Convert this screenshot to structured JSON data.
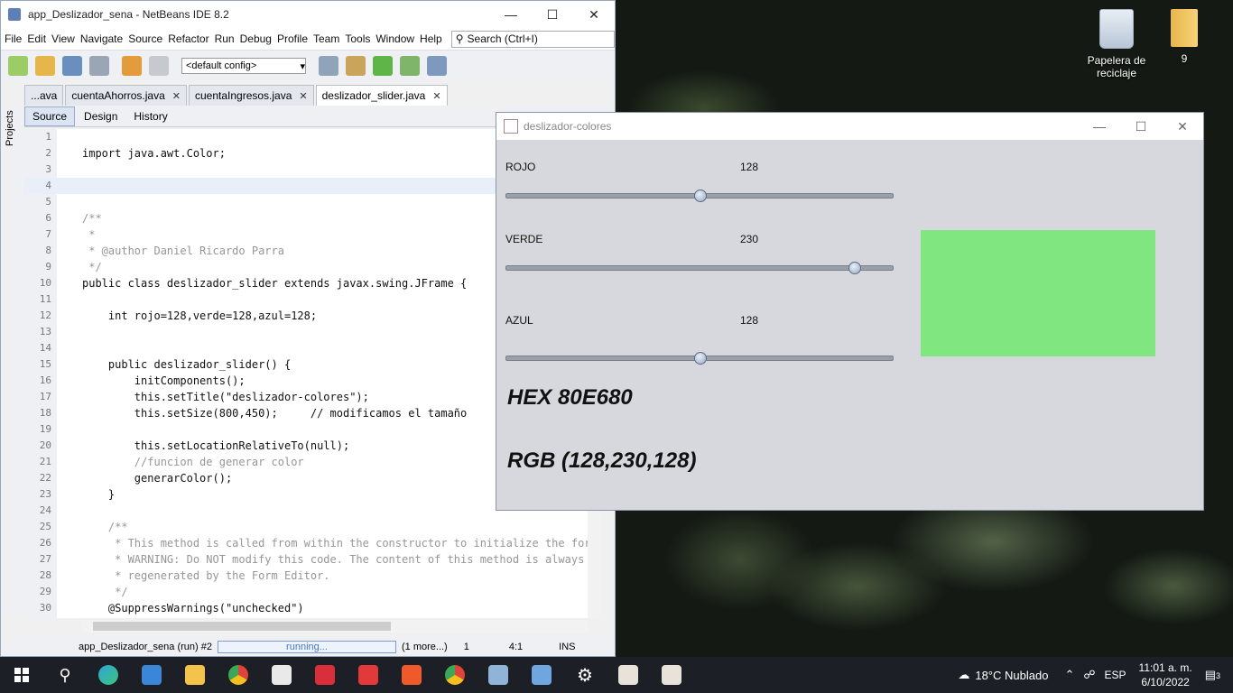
{
  "desktop": {
    "icons": [
      {
        "label": "Papelera de reciclaje"
      },
      {
        "label": "9"
      }
    ]
  },
  "netbeans": {
    "title": "app_Deslizador_sena - NetBeans IDE 8.2",
    "menu": [
      "File",
      "Edit",
      "View",
      "Navigate",
      "Source",
      "Refactor",
      "Run",
      "Debug",
      "Profile",
      "Team",
      "Tools",
      "Window",
      "Help"
    ],
    "search_placeholder": "Search (Ctrl+I)",
    "config": "<default config>",
    "side_panel": "Projects",
    "tabs": [
      "...ava",
      "cuentaAhorros.java",
      "cuentaIngresos.java",
      "deslizador_slider.java"
    ],
    "editor_tabs": [
      "Source",
      "Design",
      "History"
    ],
    "code_lines": [
      {
        "n": "1",
        "t": ""
      },
      {
        "n": "2",
        "t": "import java.awt.Color;"
      },
      {
        "n": "3",
        "t": ""
      },
      {
        "n": "4",
        "t": ""
      },
      {
        "n": "5",
        "t": ""
      },
      {
        "n": "6",
        "t": "/**"
      },
      {
        "n": "7",
        "t": " *"
      },
      {
        "n": "8",
        "t": " * @author Daniel Ricardo Parra"
      },
      {
        "n": "9",
        "t": " */"
      },
      {
        "n": "10",
        "t": "public class deslizador_slider extends javax.swing.JFrame {"
      },
      {
        "n": "11",
        "t": ""
      },
      {
        "n": "12",
        "t": "    int rojo=128,verde=128,azul=128;"
      },
      {
        "n": "13",
        "t": ""
      },
      {
        "n": "14",
        "t": ""
      },
      {
        "n": "15",
        "t": "    public deslizador_slider() {"
      },
      {
        "n": "16",
        "t": "        initComponents();"
      },
      {
        "n": "17",
        "t": "        this.setTitle(\"deslizador-colores\");"
      },
      {
        "n": "18",
        "t": "        this.setSize(800,450);     // modificamos el tamaño"
      },
      {
        "n": "19",
        "t": ""
      },
      {
        "n": "20",
        "t": "        this.setLocationRelativeTo(null);"
      },
      {
        "n": "21",
        "t": "        //funcion de generar color"
      },
      {
        "n": "22",
        "t": "        generarColor();"
      },
      {
        "n": "23",
        "t": "    }"
      },
      {
        "n": "24",
        "t": ""
      },
      {
        "n": "25",
        "t": "    /**"
      },
      {
        "n": "26",
        "t": "     * This method is called from within the constructor to initialize the form."
      },
      {
        "n": "27",
        "t": "     * WARNING: Do NOT modify this code. The content of this method is always"
      },
      {
        "n": "28",
        "t": "     * regenerated by the Form Editor."
      },
      {
        "n": "29",
        "t": "     */"
      },
      {
        "n": "30",
        "t": "    @SuppressWarnings(\"unchecked\")"
      }
    ],
    "status": {
      "run": "app_Deslizador_sena (run) #2",
      "progress": "running...",
      "more": "(1 more...)",
      "notif": "1",
      "position": "4:1",
      "mode": "INS"
    }
  },
  "swing": {
    "title": "deslizador-colores",
    "sliders": [
      {
        "label": "ROJO",
        "value": "128",
        "fraction": 0.5
      },
      {
        "label": "VERDE",
        "value": "230",
        "fraction": 0.9
      },
      {
        "label": "AZUL",
        "value": "128",
        "fraction": 0.5
      }
    ],
    "preview_color": "#80E680",
    "hex_text": "HEX 80E680",
    "rgb_text": "RGB (128,230,128)"
  },
  "taskbar": {
    "weather": "18°C  Nublado",
    "lang": "ESP",
    "time": "11:01 a. m.",
    "date": "6/10/2022",
    "notifications": "3"
  }
}
